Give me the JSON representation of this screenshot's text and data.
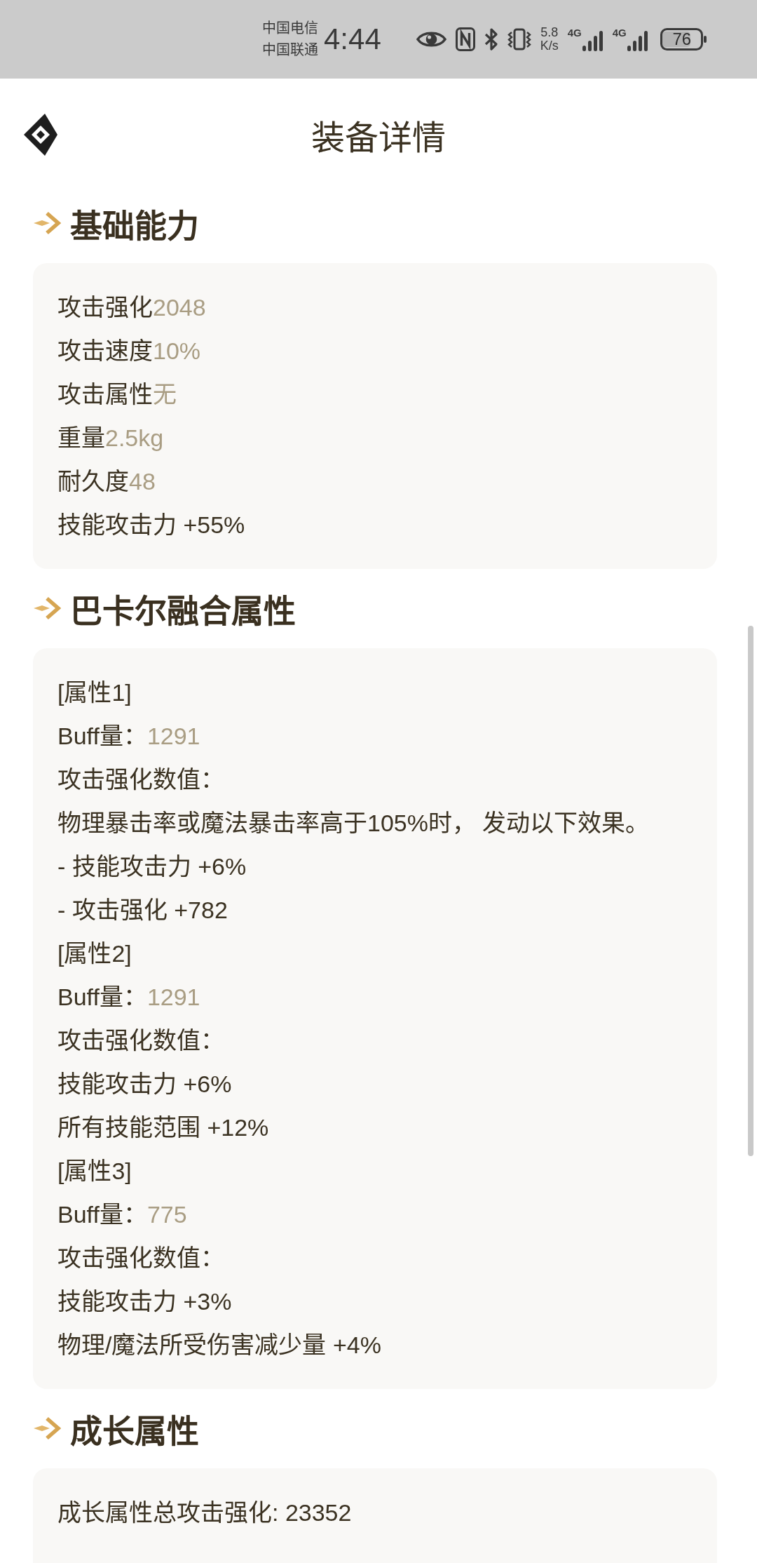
{
  "status_bar": {
    "carriers": [
      "中国电信",
      "中国联通"
    ],
    "time": "4:44",
    "net_speed": {
      "value": "5.8",
      "unit": "K/s"
    },
    "network_types": [
      "4G",
      "4G"
    ],
    "battery": "76"
  },
  "header": {
    "title": "装备详情"
  },
  "sections": [
    {
      "title": "基础能力",
      "lines": [
        {
          "text": "攻击强化",
          "value": "2048"
        },
        {
          "text": "攻击速度",
          "value": "10%"
        },
        {
          "text": "攻击属性",
          "value": "无"
        },
        {
          "text": "重量",
          "value": "2.5kg"
        },
        {
          "text": "耐久度",
          "value": "48"
        },
        {
          "text": "技能攻击力 +55%"
        }
      ]
    },
    {
      "title": "巴卡尔融合属性",
      "lines": [
        {
          "text": "[属性1]"
        },
        {
          "text": "Buff量：",
          "value": "1291"
        },
        {
          "text": "攻击强化数值："
        },
        {
          "text": "物理暴击率或魔法暴击率高于105%时， 发动以下效果。"
        },
        {
          "text": "- 技能攻击力 +6%"
        },
        {
          "text": "- 攻击强化 +782"
        },
        {
          "text": "[属性2]"
        },
        {
          "text": "Buff量：",
          "value": "1291"
        },
        {
          "text": "攻击强化数值："
        },
        {
          "text": "技能攻击力 +6%"
        },
        {
          "text": "所有技能范围 +12%"
        },
        {
          "text": "[属性3]"
        },
        {
          "text": "Buff量：",
          "value": "775"
        },
        {
          "text": "攻击强化数值："
        },
        {
          "text": "技能攻击力 +3%"
        },
        {
          "text": "物理/魔法所受伤害减少量 +4%"
        }
      ]
    },
    {
      "title": "成长属性",
      "lines": [
        {
          "text": "成长属性总攻击强化: 23352"
        }
      ]
    }
  ]
}
